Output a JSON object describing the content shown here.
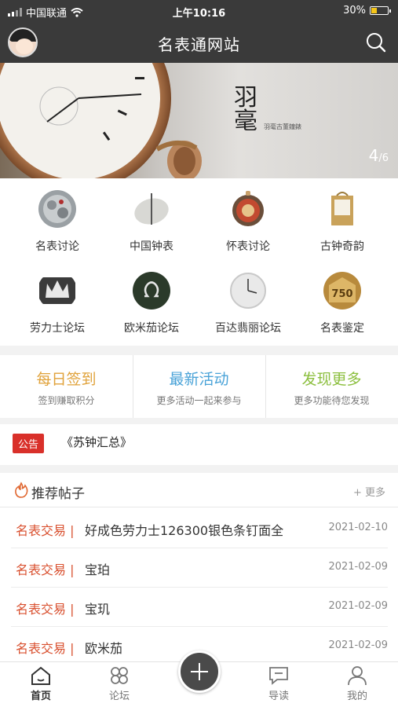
{
  "status_bar": {
    "carrier": "中国联通",
    "time": "上午10:16",
    "battery": "30%",
    "battery_level": 0.3
  },
  "header": {
    "title": "名表通网站"
  },
  "banner": {
    "logo_text": "羽毫",
    "subtitle": "羽毫古董鐘錶",
    "counter_current": "4",
    "counter_total": "/6"
  },
  "categories": [
    {
      "label": "名表讨论",
      "icon": "movement-icon"
    },
    {
      "label": "中国钟表",
      "icon": "sundial-icon"
    },
    {
      "label": "怀表讨论",
      "icon": "pocket-watch-icon"
    },
    {
      "label": "古钟奇韵",
      "icon": "carriage-clock-icon"
    },
    {
      "label": "劳力士论坛",
      "icon": "rolex-crown-icon"
    },
    {
      "label": "欧米茄论坛",
      "icon": "omega-icon"
    },
    {
      "label": "百达翡丽论坛",
      "icon": "patek-watch-icon"
    },
    {
      "label": "名表鉴定",
      "icon": "hallmark-750-icon"
    }
  ],
  "hallmark_text": "750",
  "quick_actions": [
    {
      "title": "每日签到",
      "subtitle": "签到赚取积分",
      "color": "#e0a23a"
    },
    {
      "title": "最新活动",
      "subtitle": "更多活动一起来参与",
      "color": "#4aa3d8"
    },
    {
      "title": "发现更多",
      "subtitle": "更多功能待您发现",
      "color": "#8cbf3f"
    }
  ],
  "notice": {
    "tag": "公告",
    "text": "《苏钟汇总》"
  },
  "recommended": {
    "title": "推荐帖子",
    "more": "+ 更多",
    "posts": [
      {
        "category": "名表交易 |",
        "title": "好成色劳力士126300银色条钉面全",
        "date": "2021-02-10"
      },
      {
        "category": "名表交易 |",
        "title": "宝珀",
        "date": "2021-02-09"
      },
      {
        "category": "名表交易 |",
        "title": "宝玑",
        "date": "2021-02-09"
      },
      {
        "category": "名表交易 |",
        "title": "欧米茄",
        "date": "2021-02-09"
      }
    ]
  },
  "tabbar": [
    {
      "label": "首页",
      "icon": "home-icon"
    },
    {
      "label": "论坛",
      "icon": "forum-icon"
    },
    {
      "label": "导读",
      "icon": "chat-icon"
    },
    {
      "label": "我的",
      "icon": "user-icon"
    }
  ]
}
